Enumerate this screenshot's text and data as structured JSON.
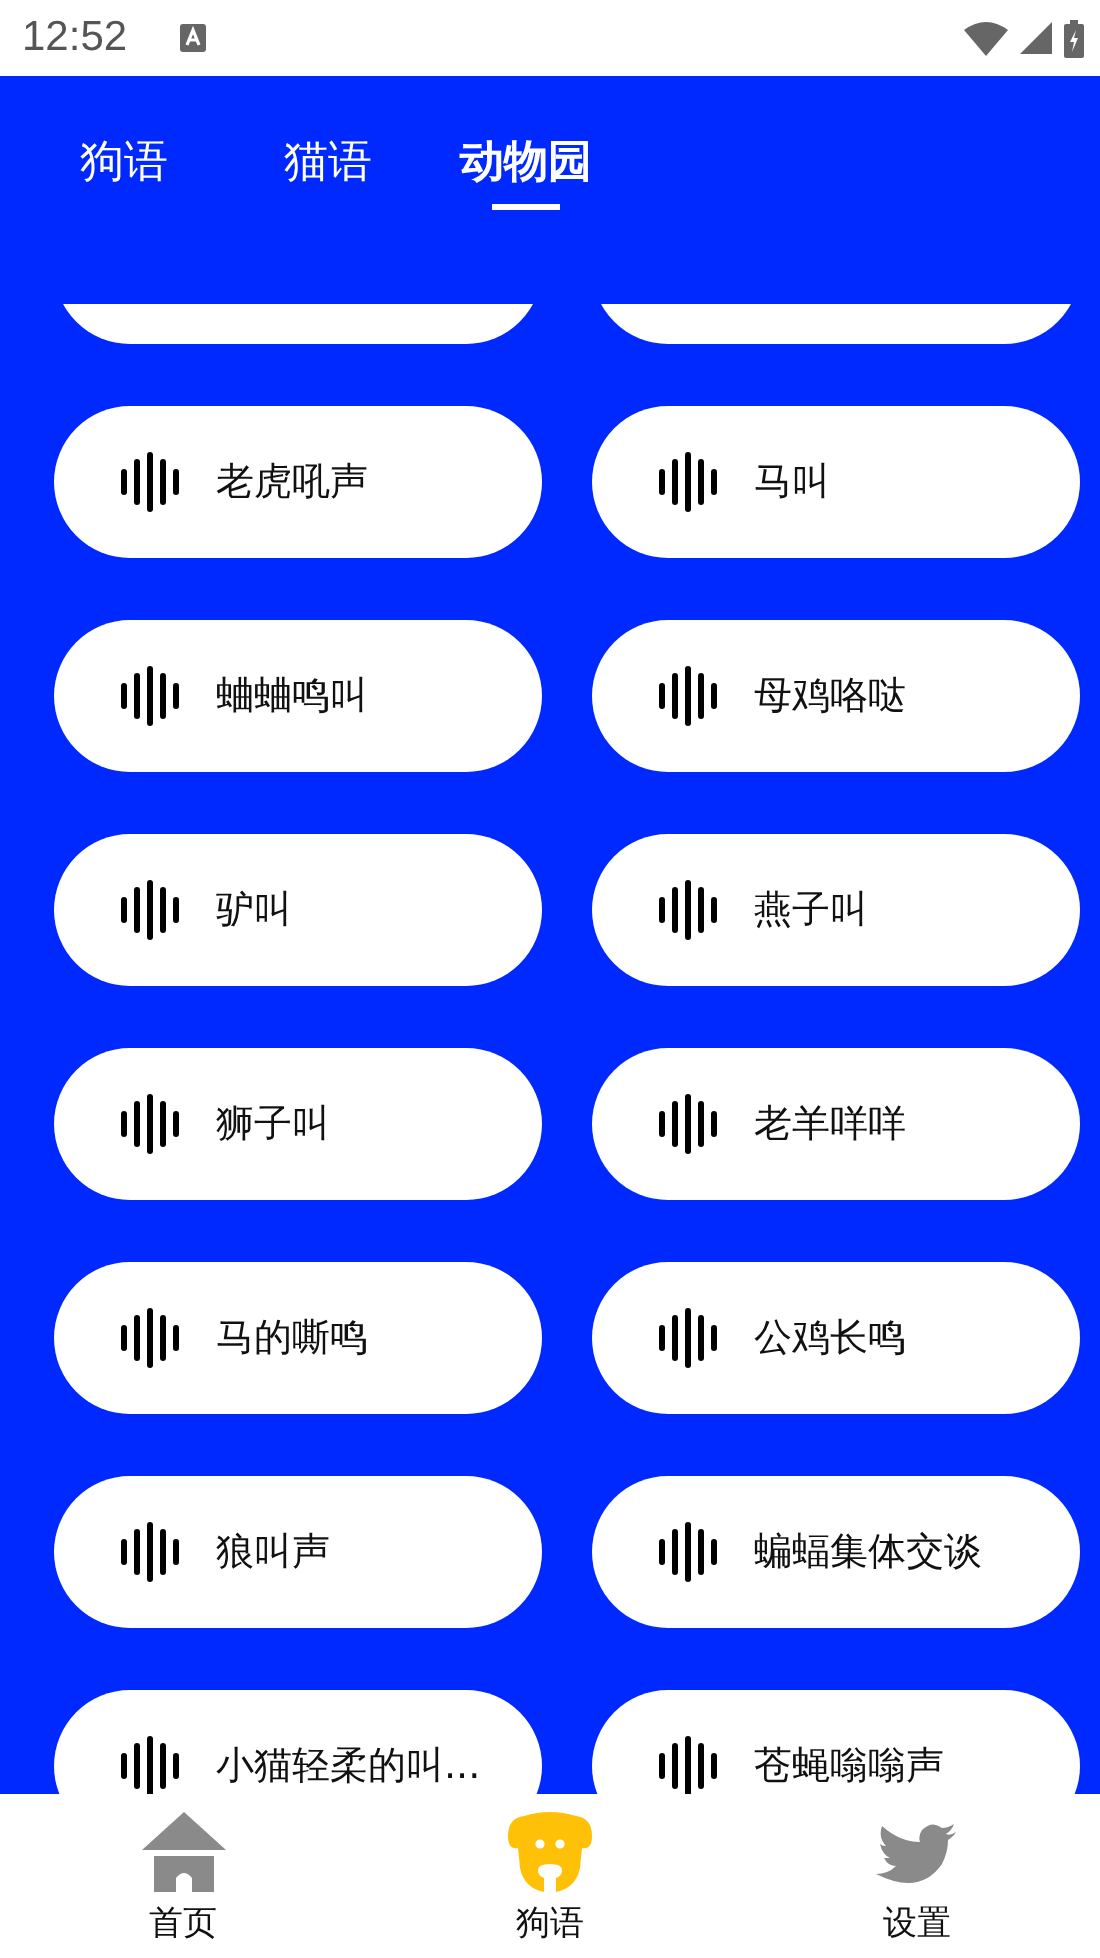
{
  "status_bar": {
    "time": "12:52"
  },
  "tabs": [
    {
      "label": "狗语",
      "selected": false
    },
    {
      "label": "猫语",
      "selected": false
    },
    {
      "label": "动物园",
      "selected": true
    }
  ],
  "sounds": [
    {
      "label": "老虎吼声"
    },
    {
      "label": "马叫"
    },
    {
      "label": "蛐蛐鸣叫"
    },
    {
      "label": "母鸡咯哒"
    },
    {
      "label": "驴叫"
    },
    {
      "label": "燕子叫"
    },
    {
      "label": "狮子叫"
    },
    {
      "label": "老羊咩咩"
    },
    {
      "label": "马的嘶鸣"
    },
    {
      "label": "公鸡长鸣"
    },
    {
      "label": "狼叫声"
    },
    {
      "label": "蝙蝠集体交谈"
    },
    {
      "label": "小猫轻柔的叫..."
    },
    {
      "label": "苍蝇嗡嗡声"
    }
  ],
  "bottom_nav": [
    {
      "kind": "home",
      "label": "首页",
      "selected": false
    },
    {
      "kind": "dog",
      "label": "狗语",
      "selected": true
    },
    {
      "kind": "bird",
      "label": "设置",
      "selected": false
    }
  ]
}
